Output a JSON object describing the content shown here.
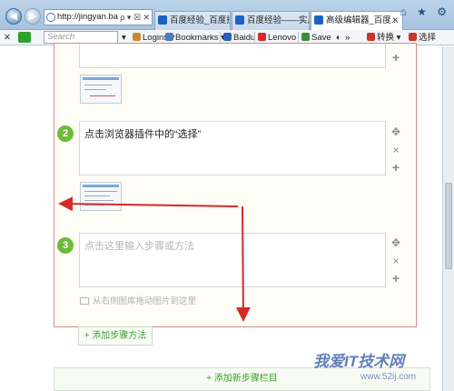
{
  "browser": {
    "address": "http://jingyan.baidu...",
    "address_tools": "ρ ▾ ☒ ✕",
    "tabs": [
      {
        "label": "百度经验_百度搜索",
        "close": ""
      },
      {
        "label": "百度经验——实用生...",
        "close": ""
      },
      {
        "label": "高级编辑器_百度...",
        "close": "✕"
      }
    ],
    "window_icons": "⌂ ★ ⚙"
  },
  "toolbar": {
    "close": "✕",
    "search_placeholder": "Search",
    "logins": "Logins ▾",
    "bookmarks": "Bookmarks ▾",
    "baidu": "Baidu",
    "lenovo": "Lenovo",
    "save": "Save",
    "translate": "转换 ▾",
    "select": "选择"
  },
  "editor": {
    "steps": [
      {
        "number": "2",
        "text": "点击浏览器插件中的“选择”"
      },
      {
        "number": "3",
        "placeholder": "点击这里输入步骤或方法",
        "hint": "从右侧图库拖动图片到这里"
      }
    ],
    "controls": {
      "move": "✥",
      "delete": "×",
      "add": "+"
    },
    "add_method": "+ 添加步骤方法",
    "add_section": "+ 添加新步骤栏目"
  },
  "watermark": {
    "title": "我爱IT技术网",
    "url": "www.52ij.com"
  },
  "colors": {
    "accent_green": "#6cbb3c",
    "frame_border": "#d68b8b",
    "arrow_red": "#d42a2a"
  }
}
